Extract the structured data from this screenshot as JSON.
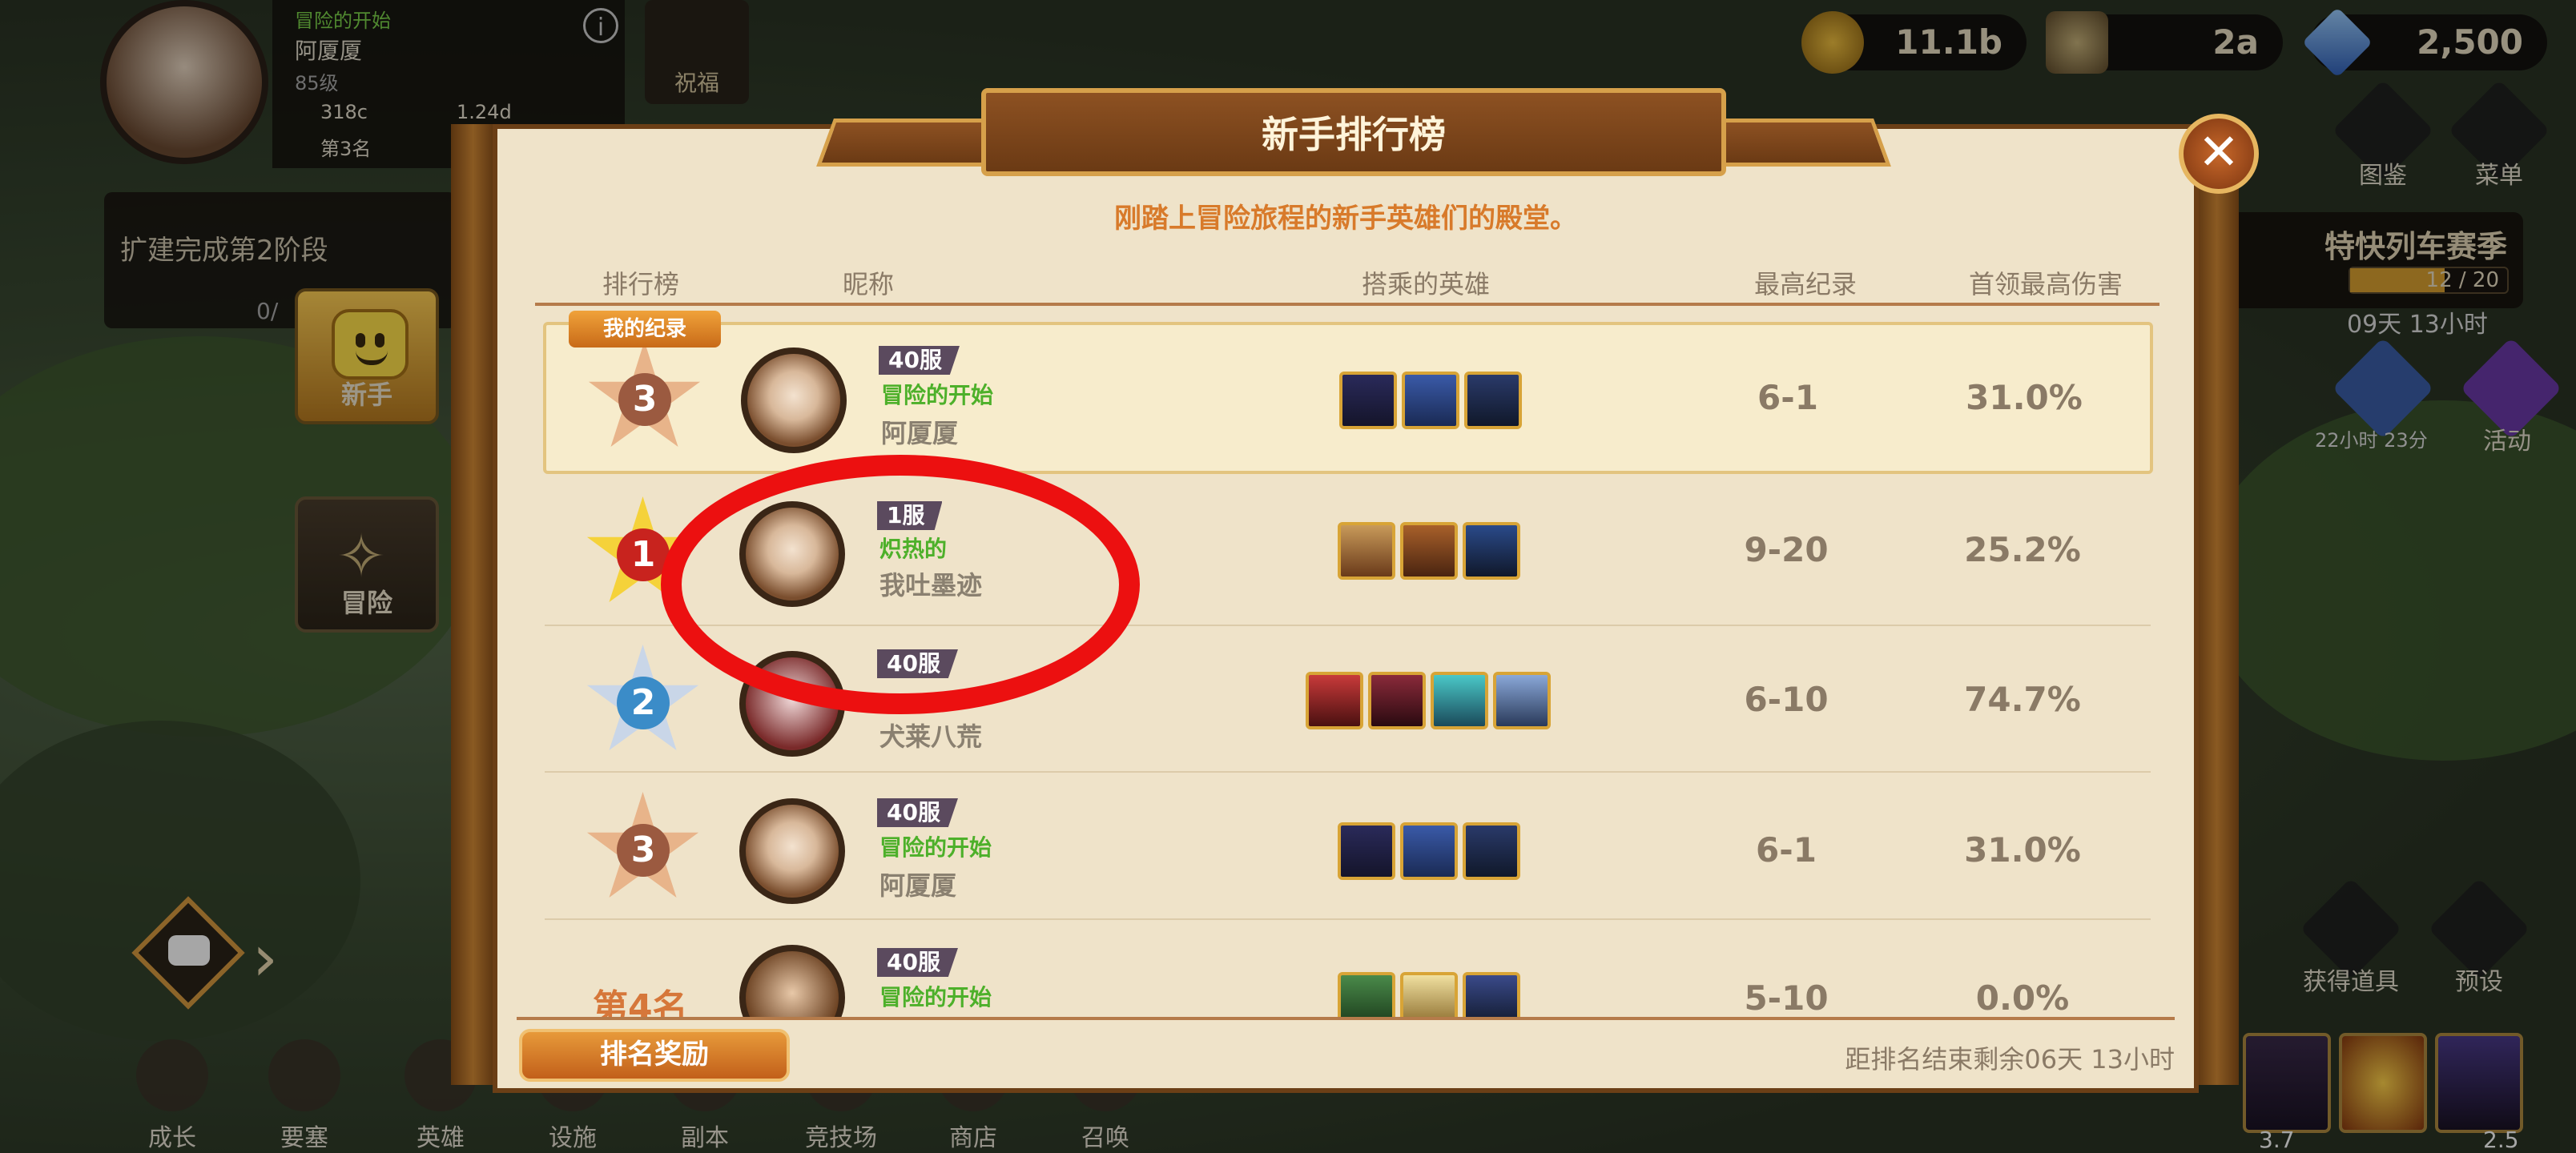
{
  "player": {
    "title": "冒险的开始",
    "name": "阿厦厦",
    "level": "85级",
    "power": "318c",
    "gold_rate": "1.24d",
    "rank": "第3名"
  },
  "expand": {
    "text": "扩建完成第2阶段",
    "progress": "0/"
  },
  "side_tabs": {
    "newbie": "新手",
    "adventure": "冒险"
  },
  "bless": {
    "label": "祝福"
  },
  "currency": {
    "gold": "11.1b",
    "food": "2a",
    "gems": "2,500"
  },
  "top_right_buttons": [
    "图鉴",
    "菜单"
  ],
  "train_event": {
    "label": "特快列车赛季",
    "progress": "12 / 20",
    "progress_fraction": 0.6,
    "timer": "09天 13小时"
  },
  "sale": {
    "timer": "22小时 23分",
    "event_label": "活动"
  },
  "right_actions": {
    "get_items": "获得道具",
    "preset": "预设"
  },
  "bottom_nav": [
    "成长",
    "要塞",
    "英雄",
    "设施",
    "副本",
    "竞技场",
    "商店",
    "召唤"
  ],
  "bottom_right_values": [
    "3.7",
    "2.5"
  ],
  "modal": {
    "title": "新手排行榜",
    "subtitle": "刚踏上冒险旅程的新手英雄们的殿堂。",
    "headers": {
      "rank": "排行榜",
      "nickname": "昵称",
      "heroes": "搭乘的英雄",
      "best": "最高纪录",
      "boss_damage": "首领最高伤害"
    },
    "my_record_badge": "我的纪录",
    "rows": [
      {
        "rank": "3",
        "server": "40服",
        "title": "冒险的开始",
        "name": "阿厦厦",
        "best": "6-1",
        "damage": "31.0%"
      },
      {
        "rank": "1",
        "server": "1服",
        "title": "炽热的",
        "name": "我吐墨迹",
        "best": "9-20",
        "damage": "25.2%"
      },
      {
        "rank": "2",
        "server": "40服",
        "title": "",
        "name": "犬莱八荒",
        "best": "6-10",
        "damage": "74.7%"
      },
      {
        "rank": "3",
        "server": "40服",
        "title": "冒险的开始",
        "name": "阿厦厦",
        "best": "6-1",
        "damage": "31.0%"
      },
      {
        "rank": "第4名",
        "server": "40服",
        "title": "冒险的开始",
        "name": "",
        "best": "5-10",
        "damage": "0.0%"
      }
    ],
    "reward_button": "排名奖励",
    "countdown": "距排名结束剩余06天 13小时"
  },
  "colors": {
    "annotation": "#ec1010",
    "accent": "#d87a2a",
    "title_green": "#4db02a"
  }
}
